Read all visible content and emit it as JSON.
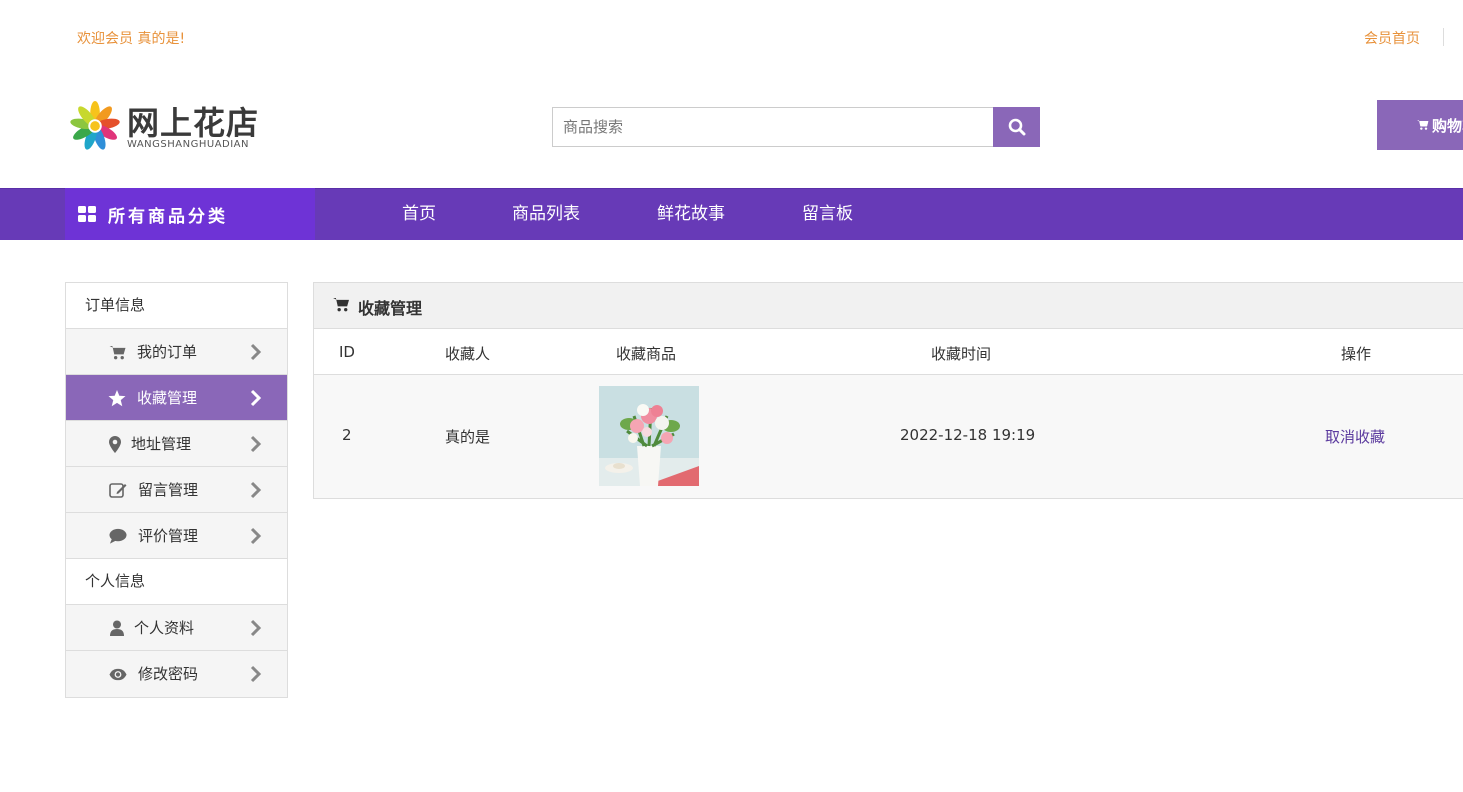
{
  "topbar": {
    "welcome_text": "欢迎会员 真的是!",
    "member_home": "会员首页"
  },
  "logo": {
    "name": "网上花店",
    "pinyin": "WANGSHANGHUADIAN"
  },
  "search": {
    "placeholder": "商品搜索",
    "button_icon": "search-icon"
  },
  "cart": {
    "label": "购物车",
    "icon": "cart-icon"
  },
  "nav": {
    "category_label": "所有商品分类",
    "links": [
      "首页",
      "商品列表",
      "鲜花故事",
      "留言板"
    ]
  },
  "sidebar": {
    "order_section": "订单信息",
    "order_items": [
      {
        "label": "我的订单",
        "icon": "cart-icon"
      },
      {
        "label": "收藏管理",
        "icon": "star-icon",
        "active": true
      },
      {
        "label": "地址管理",
        "icon": "map-marker-icon"
      },
      {
        "label": "留言管理",
        "icon": "edit-icon"
      },
      {
        "label": "评价管理",
        "icon": "comment-icon"
      }
    ],
    "personal_section": "个人信息",
    "personal_items": [
      {
        "label": "个人资料",
        "icon": "user-icon"
      },
      {
        "label": "修改密码",
        "icon": "eye-icon"
      }
    ]
  },
  "panel": {
    "title": "收藏管理",
    "columns": [
      "ID",
      "收藏人",
      "收藏商品",
      "收藏时间",
      "操作"
    ],
    "rows": [
      {
        "id": "2",
        "user": "真的是",
        "product_image": "flower-bouquet-image",
        "time": "2022-12-18 19:19",
        "action": "取消收藏"
      }
    ]
  },
  "colors": {
    "brand_purple": "#673ab7",
    "accent_purple": "#8a67b8",
    "category_purple": "#6e33d6",
    "welcome_orange": "#e8923b"
  }
}
